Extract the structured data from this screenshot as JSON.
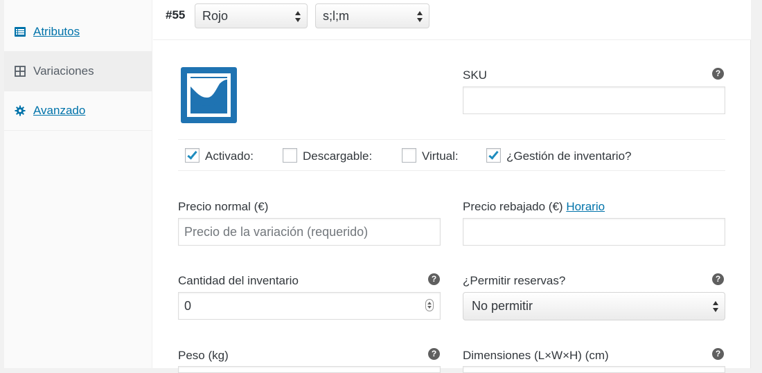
{
  "sidebar": {
    "items": [
      {
        "label": "Atributos",
        "icon": "list-icon"
      },
      {
        "label": "Variaciones",
        "icon": "grid-icon"
      },
      {
        "label": "Avanzado",
        "icon": "gear-icon"
      }
    ]
  },
  "variation": {
    "number": "#55",
    "attribute_color": "Rojo",
    "attribute_size": "s;l;m"
  },
  "fields": {
    "sku_label": "SKU",
    "sku_value": "",
    "checkboxes": [
      {
        "label": "Activado:",
        "checked": true
      },
      {
        "label": "Descargable:",
        "checked": false
      },
      {
        "label": "Virtual:",
        "checked": false
      },
      {
        "label": "¿Gestión de inventario?",
        "checked": true
      }
    ],
    "regular_price_label": "Precio normal (€)",
    "regular_price_placeholder": "Precio de la variación (requerido)",
    "sale_price_label": "Precio rebajado (€)",
    "sale_schedule_link": "Horario",
    "stock_qty_label": "Cantidad del inventario",
    "stock_qty_value": "0",
    "backorders_label": "¿Permitir reservas?",
    "backorders_value": "No permitir",
    "weight_label": "Peso (kg)",
    "dimensions_label": "Dimensiones (L×W×H) (cm)",
    "help_glyph": "?"
  },
  "colors": {
    "accent": "#0073aa",
    "checkmark": "#1e8cbe",
    "image_placeholder": "#1f73b2"
  }
}
